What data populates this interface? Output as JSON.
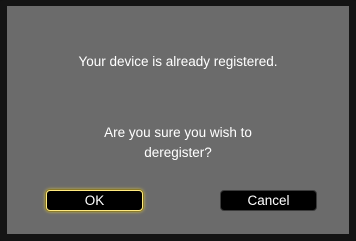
{
  "dialog": {
    "message_line_1": "Your device is already registered.",
    "message_line_2": "Are you sure you wish to",
    "message_line_3": "deregister?"
  },
  "buttons": {
    "ok_label": "OK",
    "cancel_label": "Cancel"
  },
  "colors": {
    "dialog_background": "#6b6b6b",
    "frame_background": "#141414",
    "button_background": "#000000",
    "focus_highlight": "#ffea80"
  }
}
